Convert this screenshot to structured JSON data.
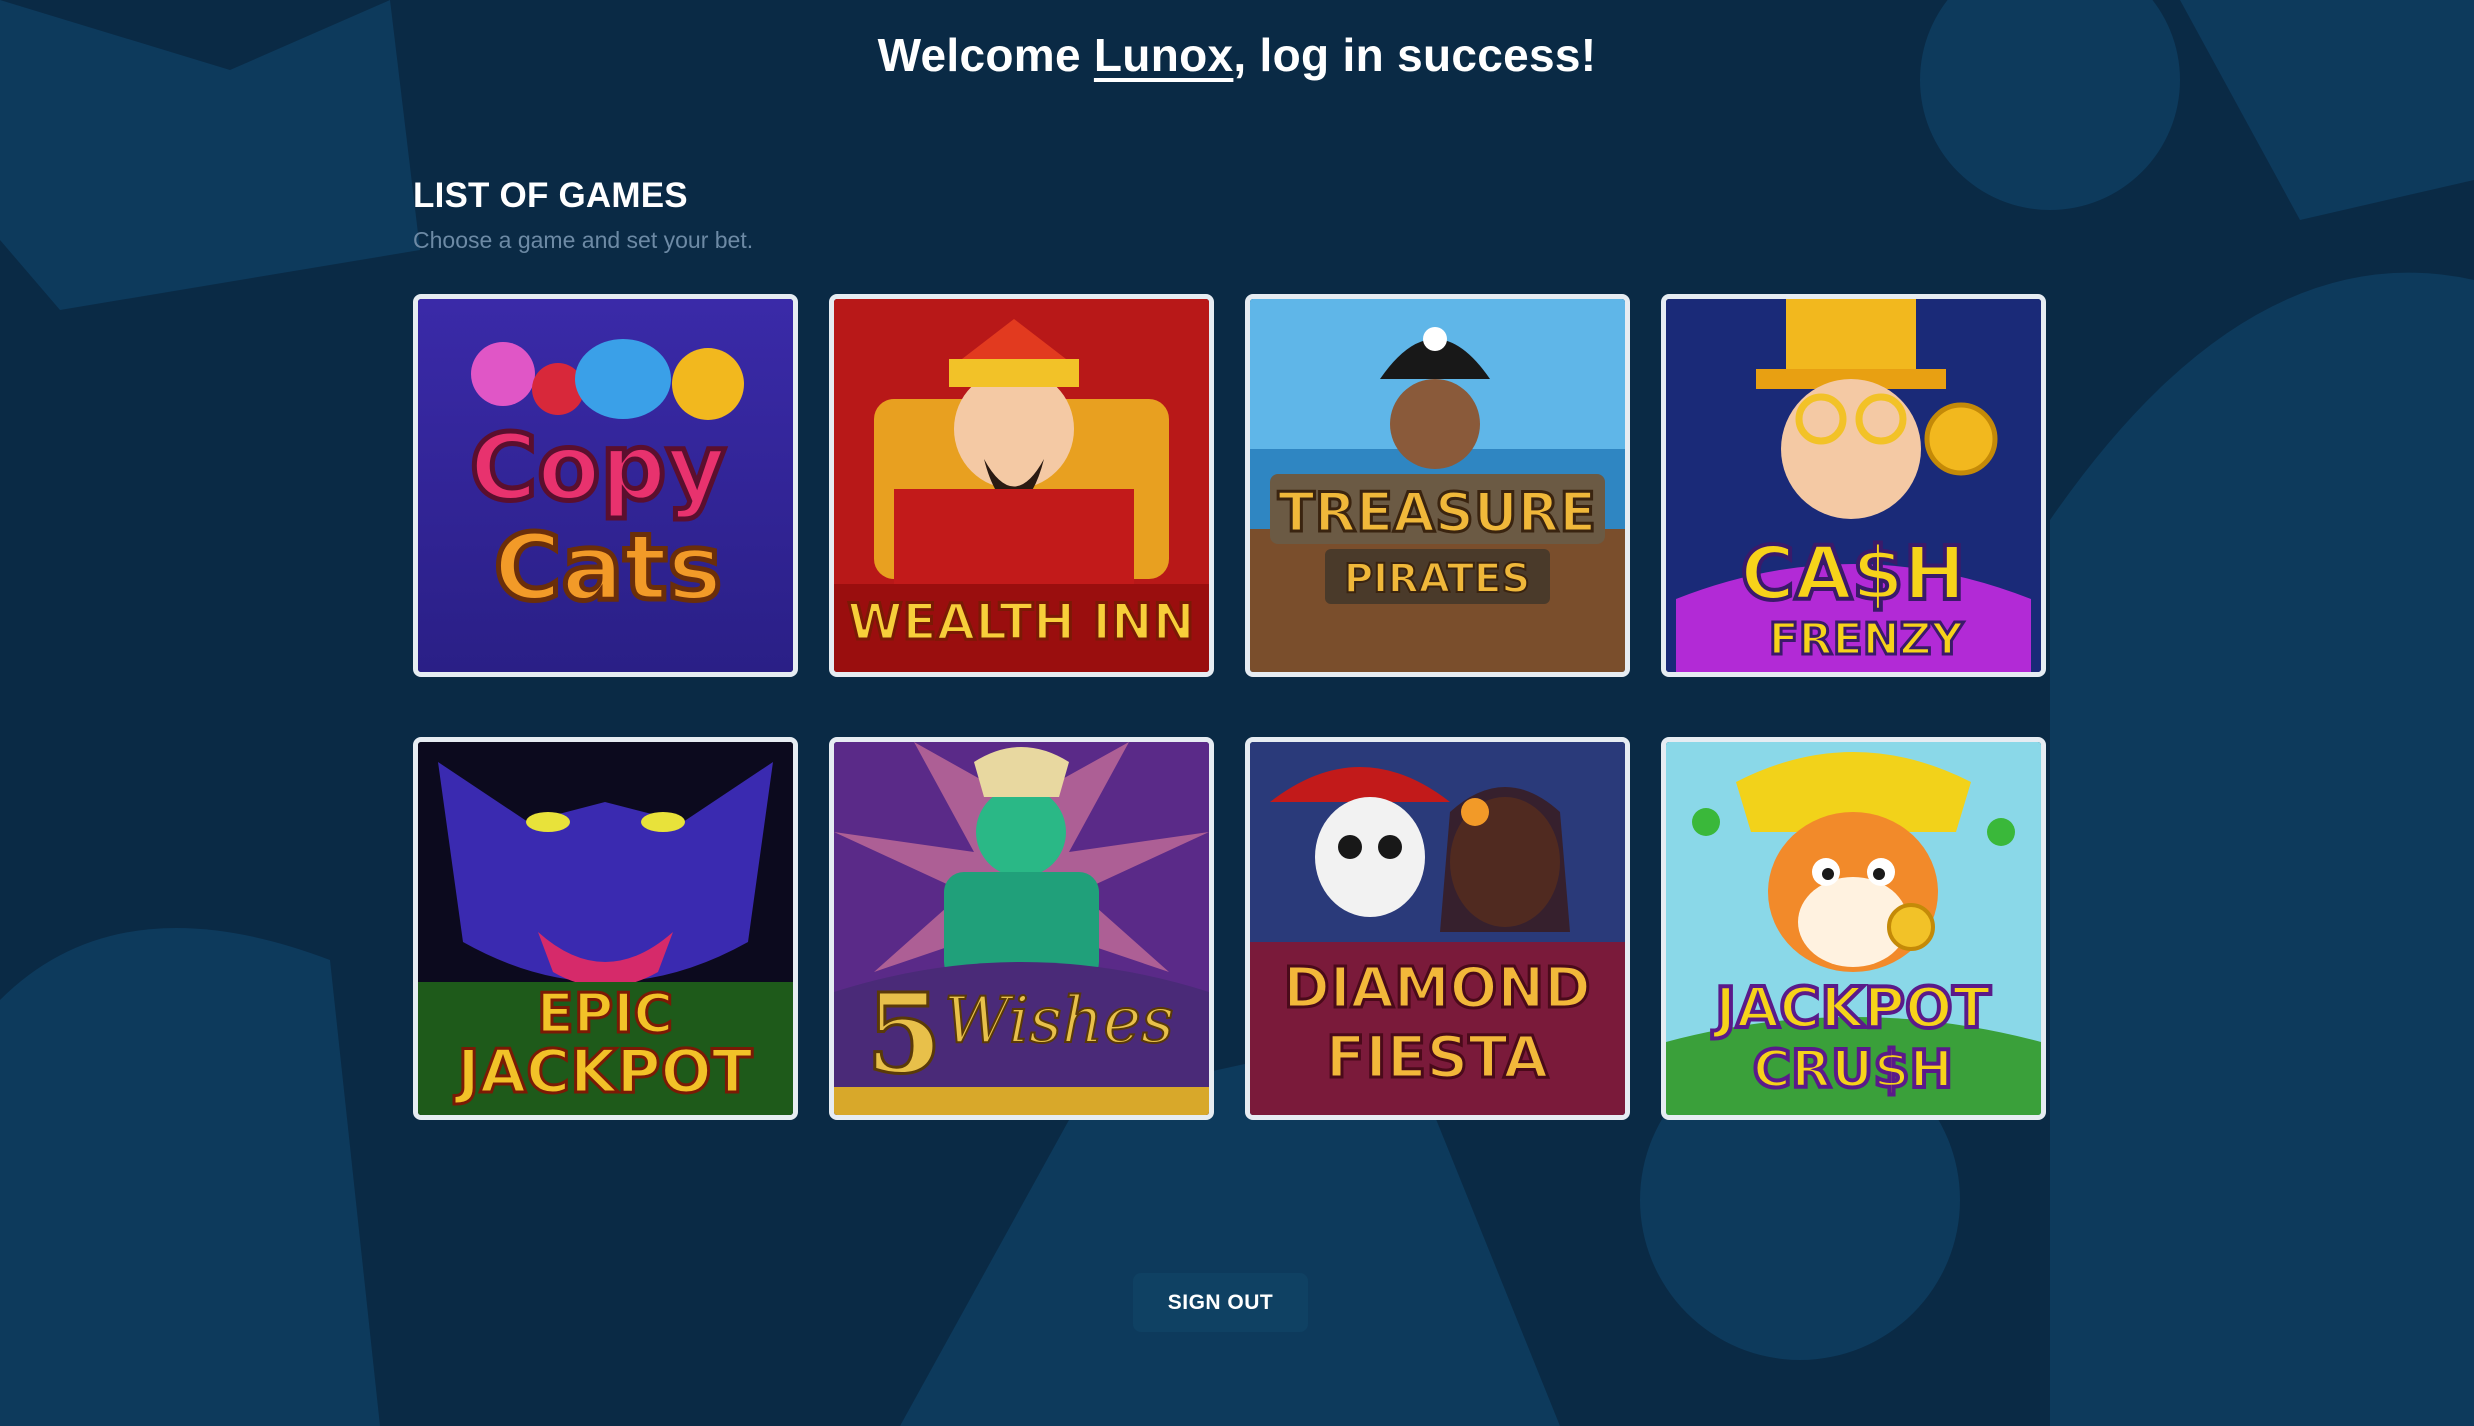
{
  "header": {
    "welcome_prefix": "Welcome ",
    "username": "Lunox",
    "welcome_suffix": ", log in success!"
  },
  "games_section": {
    "title": "LIST OF GAMES",
    "subtitle": "Choose a game and set your bet."
  },
  "games": [
    {
      "name": "Copy Cats",
      "line1": "Copy",
      "line2": "Cats"
    },
    {
      "name": "Wealth Inn",
      "line1": "WEALTH INN",
      "line2": ""
    },
    {
      "name": "Treasure Pirates",
      "line1": "TREASURE",
      "line2": "PIRATES"
    },
    {
      "name": "Cash Frenzy",
      "line1": "CA$H",
      "line2": "FRENZY"
    },
    {
      "name": "Epic Jackpot",
      "line1": "EPIC",
      "line2": "JACKPOT"
    },
    {
      "name": "5 Wishes",
      "line1": "5",
      "line2": "Wishes"
    },
    {
      "name": "Diamond Fiesta",
      "line1": "DIAMOND",
      "line2": "FIESTA"
    },
    {
      "name": "Jackpot Crush",
      "line1": "JACKPOT",
      "line2": "CRU$H"
    }
  ],
  "actions": {
    "sign_out_label": "SIGN OUT"
  },
  "colors": {
    "background": "#0a2a45",
    "background_shapes": "#0d3a5c",
    "card_border": "#e6ecf2",
    "button_bg": "#0f4163",
    "subtitle_text": "#6d8aa5"
  }
}
